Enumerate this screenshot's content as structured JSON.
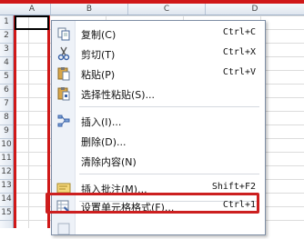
{
  "spreadsheet": {
    "columns": [
      "A",
      "B",
      "C",
      "D"
    ],
    "rows": [
      "1",
      "2",
      "3",
      "4",
      "5",
      "6",
      "7",
      "8",
      "9",
      "10",
      "11",
      "12",
      "13",
      "14",
      "15"
    ]
  },
  "context_menu": {
    "items": [
      {
        "label": "复制(C)",
        "shortcut": "Ctrl+C",
        "icon": "copy-icon"
      },
      {
        "label": "剪切(T)",
        "shortcut": "Ctrl+X",
        "icon": "cut-icon"
      },
      {
        "label": "粘贴(P)",
        "shortcut": "Ctrl+V",
        "icon": "paste-icon"
      },
      {
        "label": "选择性粘贴(S)...",
        "shortcut": "",
        "icon": "paste-special-icon"
      },
      {
        "label": "插入(I)...",
        "shortcut": "",
        "icon": "insert-icon"
      },
      {
        "label": "删除(D)...",
        "shortcut": "",
        "icon": ""
      },
      {
        "label": "清除内容(N)",
        "shortcut": "",
        "icon": ""
      },
      {
        "label": "插入批注(M)...",
        "shortcut": "Shift+F2",
        "icon": "insert-comment-icon"
      },
      {
        "label": "设置单元格格式(F)...",
        "shortcut": "Ctrl+1",
        "icon": "format-cells-icon"
      }
    ]
  },
  "colors": {
    "highlight": "#cc1f1f",
    "selection": "#d01818"
  }
}
